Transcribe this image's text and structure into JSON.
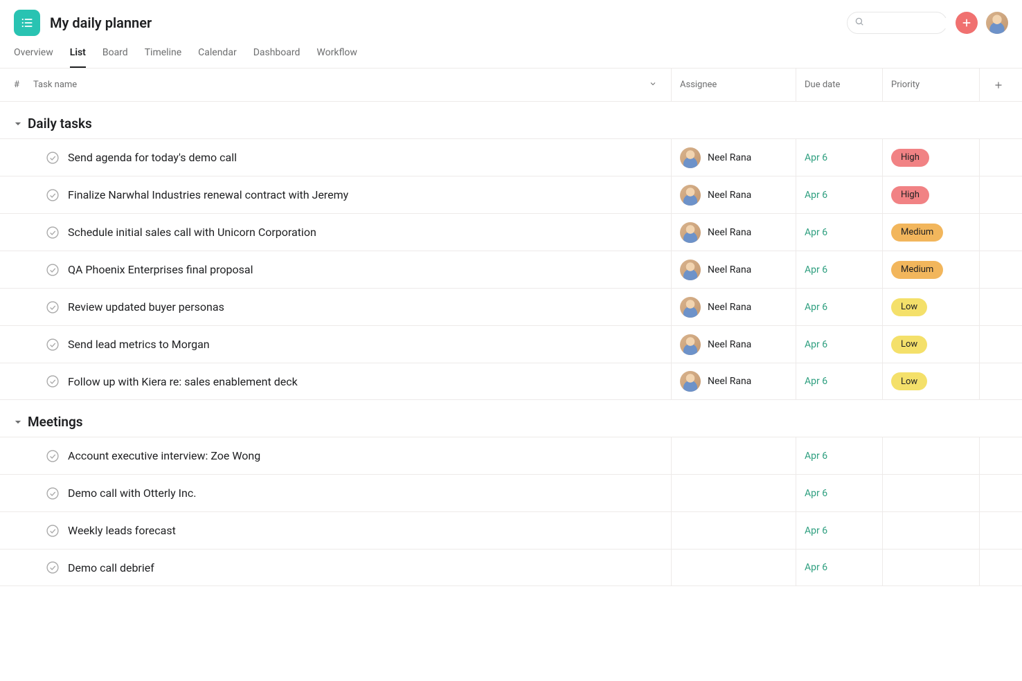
{
  "header": {
    "project_title": "My daily planner",
    "search_placeholder": ""
  },
  "tabs": [
    {
      "label": "Overview",
      "active": false
    },
    {
      "label": "List",
      "active": true
    },
    {
      "label": "Board",
      "active": false
    },
    {
      "label": "Timeline",
      "active": false
    },
    {
      "label": "Calendar",
      "active": false
    },
    {
      "label": "Dashboard",
      "active": false
    },
    {
      "label": "Workflow",
      "active": false
    }
  ],
  "columns": {
    "num": "#",
    "task": "Task name",
    "assignee": "Assignee",
    "due": "Due date",
    "priority": "Priority"
  },
  "sections": [
    {
      "title": "Daily tasks",
      "tasks": [
        {
          "name": "Send agenda for today's demo call",
          "assignee": "Neel Rana",
          "due": "Apr 6",
          "priority": "High",
          "pill": "pill-high"
        },
        {
          "name": "Finalize Narwhal Industries renewal contract with Jeremy",
          "assignee": "Neel Rana",
          "due": "Apr 6",
          "priority": "High",
          "pill": "pill-high"
        },
        {
          "name": "Schedule initial sales call with Unicorn Corporation",
          "assignee": "Neel Rana",
          "due": "Apr 6",
          "priority": "Medium",
          "pill": "pill-medium"
        },
        {
          "name": "QA Phoenix Enterprises final proposal",
          "assignee": "Neel Rana",
          "due": "Apr 6",
          "priority": "Medium",
          "pill": "pill-medium"
        },
        {
          "name": "Review updated buyer personas",
          "assignee": "Neel Rana",
          "due": "Apr 6",
          "priority": "Low",
          "pill": "pill-low"
        },
        {
          "name": "Send lead metrics to Morgan",
          "assignee": "Neel Rana",
          "due": "Apr 6",
          "priority": "Low",
          "pill": "pill-low"
        },
        {
          "name": "Follow up with Kiera re: sales enablement deck",
          "assignee": "Neel Rana",
          "due": "Apr 6",
          "priority": "Low",
          "pill": "pill-low"
        }
      ]
    },
    {
      "title": "Meetings",
      "tasks": [
        {
          "name": "Account executive interview: Zoe Wong",
          "assignee": "",
          "due": "Apr 6",
          "priority": "",
          "pill": ""
        },
        {
          "name": "Demo call with Otterly Inc.",
          "assignee": "",
          "due": "Apr 6",
          "priority": "",
          "pill": ""
        },
        {
          "name": "Weekly leads forecast",
          "assignee": "",
          "due": "Apr 6",
          "priority": "",
          "pill": ""
        },
        {
          "name": "Demo call debrief",
          "assignee": "",
          "due": "Apr 6",
          "priority": "",
          "pill": ""
        }
      ]
    }
  ]
}
